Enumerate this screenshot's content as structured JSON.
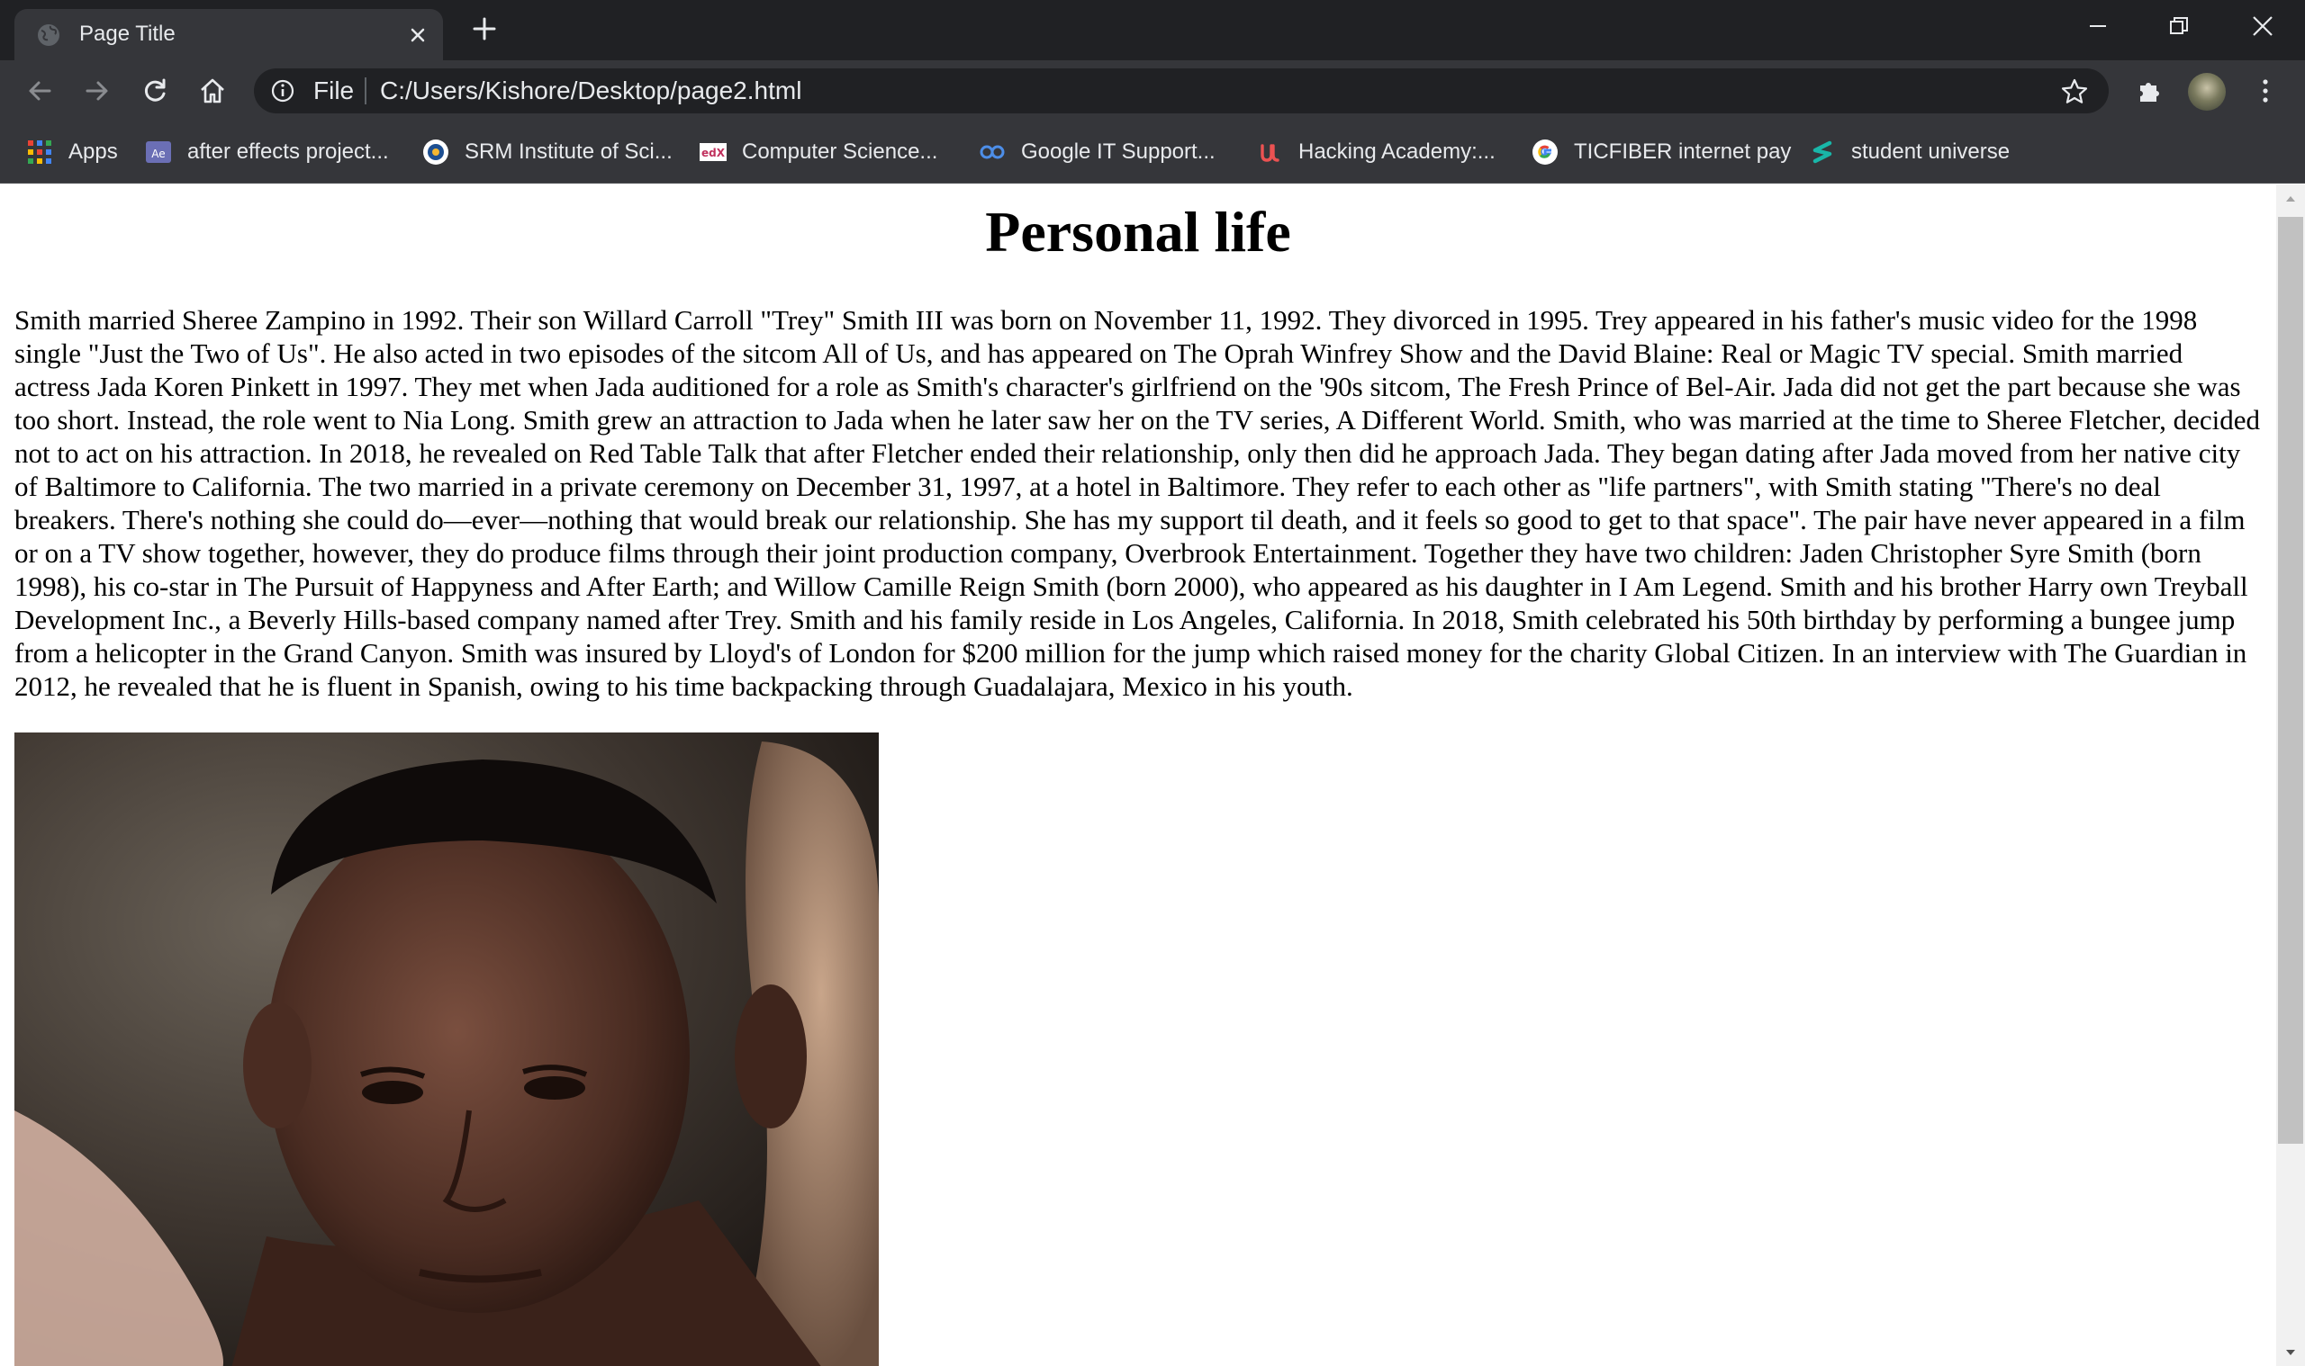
{
  "tab": {
    "title": "Page Title"
  },
  "addressbar": {
    "scheme_label": "File",
    "url": "C:/Users/Kishore/Desktop/page2.html"
  },
  "bookmarks": [
    {
      "label": "Apps",
      "icon": "apps-grid-icon"
    },
    {
      "label": "after effects project...",
      "icon": "after-effects-icon"
    },
    {
      "label": "SRM Institute of Sci...",
      "icon": "srm-logo-icon"
    },
    {
      "label": "Computer Science...",
      "icon": "edx-icon"
    },
    {
      "label": "Google IT Support...",
      "icon": "coursera-icon"
    },
    {
      "label": "Hacking Academy:...",
      "icon": "udemy-icon"
    },
    {
      "label": "TICFIBER internet pay",
      "icon": "google-icon"
    },
    {
      "label": "student universe",
      "icon": "student-universe-icon"
    }
  ],
  "page": {
    "heading": "Personal life",
    "paragraph": "Smith married Sheree Zampino in 1992. Their son Willard Carroll \"Trey\" Smith III was born on November 11, 1992. They divorced in 1995. Trey appeared in his father's music video for the 1998 single \"Just the Two of Us\". He also acted in two episodes of the sitcom All of Us, and has appeared on The Oprah Winfrey Show and the David Blaine: Real or Magic TV special. Smith married actress Jada Koren Pinkett in 1997. They met when Jada auditioned for a role as Smith's character's girlfriend on the '90s sitcom, The Fresh Prince of Bel-Air. Jada did not get the part because she was too short. Instead, the role went to Nia Long. Smith grew an attraction to Jada when he later saw her on the TV series, A Different World. Smith, who was married at the time to Sheree Fletcher, decided not to act on his attraction. In 2018, he revealed on Red Table Talk that after Fletcher ended their relationship, only then did he approach Jada. They began dating after Jada moved from her native city of Baltimore to California. The two married in a private ceremony on December 31, 1997, at a hotel in Baltimore. They refer to each other as \"life partners\", with Smith stating \"There's no deal breakers. There's nothing she could do—ever—nothing that would break our relationship. She has my support til death, and it feels so good to get to that space\". The pair have never appeared in a film or on a TV show together, however, they do produce films through their joint production company, Overbrook Entertainment. Together they have two children: Jaden Christopher Syre Smith (born 1998), his co-star in The Pursuit of Happyness and After Earth; and Willow Camille Reign Smith (born 2000), who appeared as his daughter in I Am Legend. Smith and his brother Harry own Treyball Development Inc., a Beverly Hills-based company named after Trey. Smith and his family reside in Los Angeles, California. In 2018, Smith celebrated his 50th birthday by performing a bungee jump from a helicopter in the Grand Canyon. Smith was insured by Lloyd's of London for $200 million for the jump which raised money for the charity Global Citizen. In an interview with The Guardian in 2012, he revealed that he is fluent in Spanish, owing to his time backpacking through Guadalajara, Mexico in his youth.",
    "image_subject": "portrait-photo"
  },
  "colors": {
    "titlebar": "#202124",
    "toolbar": "#35363a",
    "chrome_text": "#e8eaed",
    "page_bg": "#ffffff",
    "page_text": "#000000"
  }
}
